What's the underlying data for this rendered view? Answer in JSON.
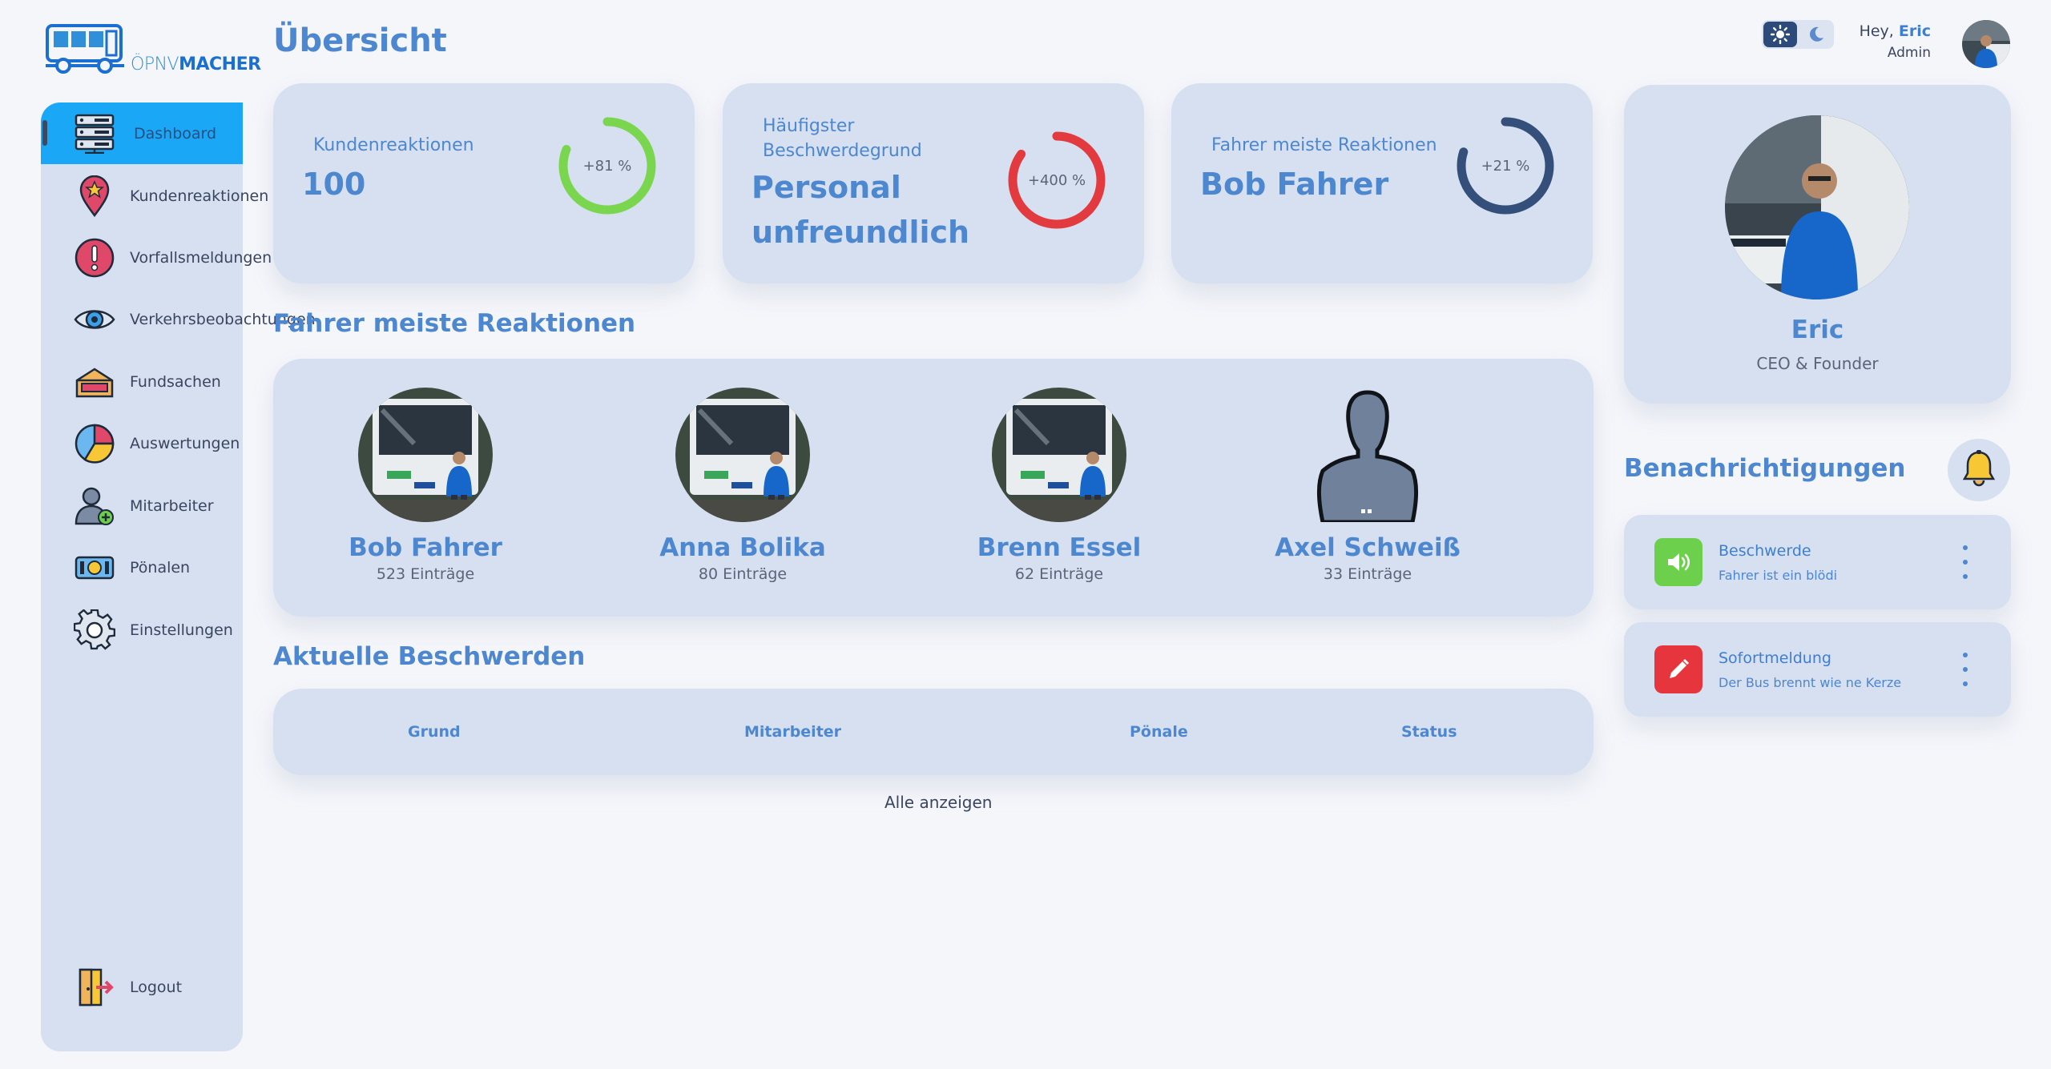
{
  "app": {
    "logo_light": "ÖPNV",
    "logo_bold": "MACHER"
  },
  "sidebar": {
    "items": [
      {
        "label": "Dashboard",
        "icon": "server-icon",
        "active": true
      },
      {
        "label": "Kundenreaktionen",
        "icon": "map-pin-star-icon"
      },
      {
        "label": "Vorfallsmeldungen",
        "icon": "alert-icon"
      },
      {
        "label": "Verkehrsbeobachtungen",
        "icon": "eye-icon"
      },
      {
        "label": "Fundsachen",
        "icon": "box-icon"
      },
      {
        "label": "Auswertungen",
        "icon": "pie-chart-icon"
      },
      {
        "label": "Mitarbeiter",
        "icon": "add-user-icon"
      },
      {
        "label": "Pönalen",
        "icon": "money-icon"
      },
      {
        "label": "Einstellungen",
        "icon": "gear-icon"
      }
    ],
    "logout": "Logout"
  },
  "header": {
    "title": "Übersicht",
    "greeting": "Hey,",
    "user": "Eric",
    "role": "Admin"
  },
  "stats": [
    {
      "label": "Kundenreaktionen",
      "value": "100",
      "percent_text": "+81 %",
      "ring_fraction": 0.81,
      "color": "#7ad64f"
    },
    {
      "label_line1": "Häufigster",
      "label_line2": "Beschwerdegrund",
      "value_line1": "Personal",
      "value_line2": "unfreundlich",
      "percent_text": "+400 %",
      "ring_fraction": 0.85,
      "color": "#e23a3f"
    },
    {
      "label": "Fahrer meiste Reaktionen",
      "value": "Bob Fahrer",
      "percent_text": "+21 %",
      "ring_fraction": 0.8,
      "color": "#34507a"
    }
  ],
  "drivers_section": {
    "title": "Fahrer meiste Reaktionen",
    "drivers": [
      {
        "name": "Bob Fahrer",
        "count": "523 Einträge",
        "photo": true
      },
      {
        "name": "Anna Bolika",
        "count": "80 Einträge",
        "photo": true
      },
      {
        "name": "Brenn Essel",
        "count": "62 Einträge",
        "photo": true
      },
      {
        "name": "Axel Schweiß",
        "count": "33 Einträge",
        "photo": false
      }
    ]
  },
  "complaints": {
    "title": "Aktuelle Beschwerden",
    "columns": [
      "Grund",
      "Mitarbeiter",
      "Pönale",
      "Status"
    ],
    "show_all": "Alle anzeigen"
  },
  "profile": {
    "name": "Eric",
    "role": "CEO & Founder"
  },
  "notifications": {
    "title": "Benachrichtigungen",
    "items": [
      {
        "title": "Beschwerde",
        "text": "Fahrer ist ein blödi",
        "icon": "speaker-icon",
        "color": "#6dd04c"
      },
      {
        "title": "Sofortmeldung",
        "text": "Der Bus brennt wie ne Kerze",
        "icon": "pencil-icon",
        "color": "#e6353c"
      }
    ]
  }
}
